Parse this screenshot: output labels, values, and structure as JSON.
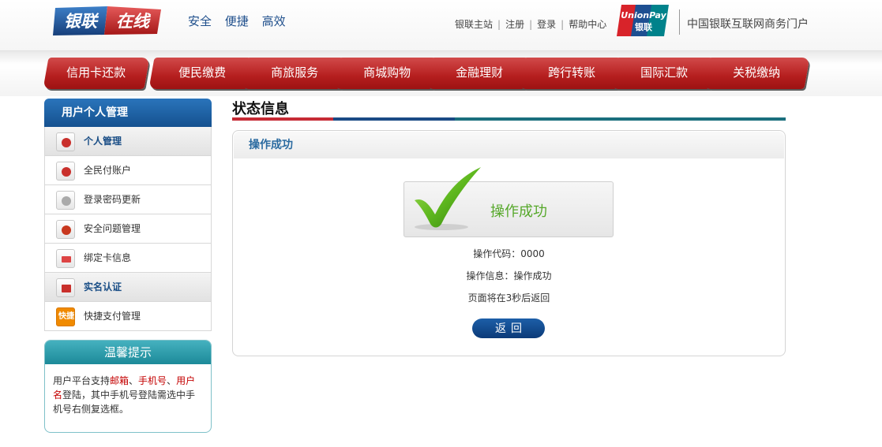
{
  "header": {
    "logo_text": "银联在线",
    "slogan": [
      "安全",
      "便捷",
      "高效"
    ],
    "toplinks": [
      "银联主站",
      "注册",
      "登录",
      "帮助中心"
    ],
    "unionpay_logo_en": "UnionPay",
    "unionpay_logo_cn": "银联",
    "portal_name": "中国银联互联网商务门户"
  },
  "nav": {
    "items": [
      "信用卡还款",
      "便民缴费",
      "商旅服务",
      "商城购物",
      "金融理财",
      "跨行转账",
      "国际汇款",
      "关税缴纳"
    ]
  },
  "sidebar": {
    "title": "用户个人管理",
    "items": [
      {
        "label": "个人管理",
        "icon": "user-icon",
        "active": true
      },
      {
        "label": "全民付账户",
        "icon": "users-icon",
        "active": false
      },
      {
        "label": "登录密码更新",
        "icon": "password-icon",
        "active": false
      },
      {
        "label": "安全问题管理",
        "icon": "gear-icon",
        "active": false
      },
      {
        "label": "绑定卡信息",
        "icon": "card-icon",
        "active": false
      },
      {
        "label": "实名认证",
        "icon": "id-card-icon",
        "active": true
      },
      {
        "label": "快捷支付管理",
        "icon": "quick-pay-icon",
        "active": false
      }
    ],
    "quick_pay_icon_text": "快捷"
  },
  "tip": {
    "title": "温馨提示",
    "text_1": "用户平台支持",
    "hl_1": "邮箱",
    "sep_1": "、",
    "hl_2": "手机号",
    "sep_2": "、",
    "hl_3": "用户名",
    "text_2": "登陆，其中手机号登陆需选中手机号右侧复选框。"
  },
  "main": {
    "title": "状态信息",
    "panel_title": "操作成功",
    "success_label": "操作成功",
    "code_line": "操作代码：0000",
    "message_line": "操作信息：操作成功",
    "redirect_line": "页面将在3秒后返回",
    "back_button": "返回"
  },
  "colors": {
    "nav_red": "#b51e1e",
    "sidebar_blue": "#15518f",
    "tip_teal": "#1c8a99",
    "success_green": "#56a82a"
  }
}
